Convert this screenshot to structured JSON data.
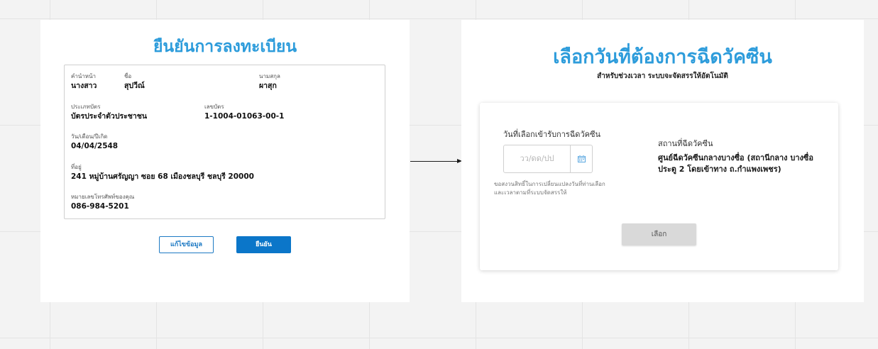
{
  "registration": {
    "title": "ยืนยันการลงทะเบียน",
    "fields": {
      "prefix": {
        "label": "คำนำหน้า",
        "value": "นางสาว"
      },
      "first_name": {
        "label": "ชื่อ",
        "value": "สุปวีณ์"
      },
      "last_name": {
        "label": "นามสกุล",
        "value": "ผาสุก"
      },
      "card_type": {
        "label": "ประเภทบัตร",
        "value": "บัตรประจำตัวประชาชน"
      },
      "card_number": {
        "label": "เลขบัตร",
        "value": "1-1004-01063-00-1"
      },
      "birth_date": {
        "label": "วัน/เดือน/ปีเกิด",
        "value": "04/04/2548"
      },
      "address": {
        "label": "ที่อยู่",
        "value": "241 หมู่บ้านศรัญญา ซอย 68 เมืองชลบุรี ชลบุรี 20000"
      },
      "phone": {
        "label": "หมายเลขโทรศัพท์ของคุณ",
        "value": "086-984-5201"
      }
    },
    "edit_button": "แก้ไขข้อมูล",
    "confirm_button": "ยืนยัน"
  },
  "vaccine_date": {
    "title": "เลือกวันที่ต้องการฉีดวัคซีน",
    "subtitle": "สำหรับช่วงเวลา ระบบจะจัดสรรให้อัตโนมัติ",
    "date_label": "วันที่เลือกเข้ารับการฉีดวัคซีน",
    "date_placeholder": "วว/ดด/ปป",
    "note_line1": "ขอสงวนสิทธิ์ในการเปลี่ยนแปลงวันที่ท่านเลือก",
    "note_line2": "และเวลาตามที่ระบบจัดสรรให้",
    "location_label": "สถานที่ฉีดวัคซีน",
    "location_name": "ศูนย์ฉีดวัคซีนกลางบางซื่อ (สถานีกลาง บางซื่อ ประตู 2 โดยเข้าทาง ถ.กำแพงเพชร)",
    "select_button": "เลือก"
  },
  "colors": {
    "accent": "#2d9cdb",
    "primary_button": "#0b76c9",
    "disabled_button": "#d9d9d9"
  },
  "icons": {
    "date_picker": "calendar-icon",
    "flow": "arrow-right-icon"
  }
}
